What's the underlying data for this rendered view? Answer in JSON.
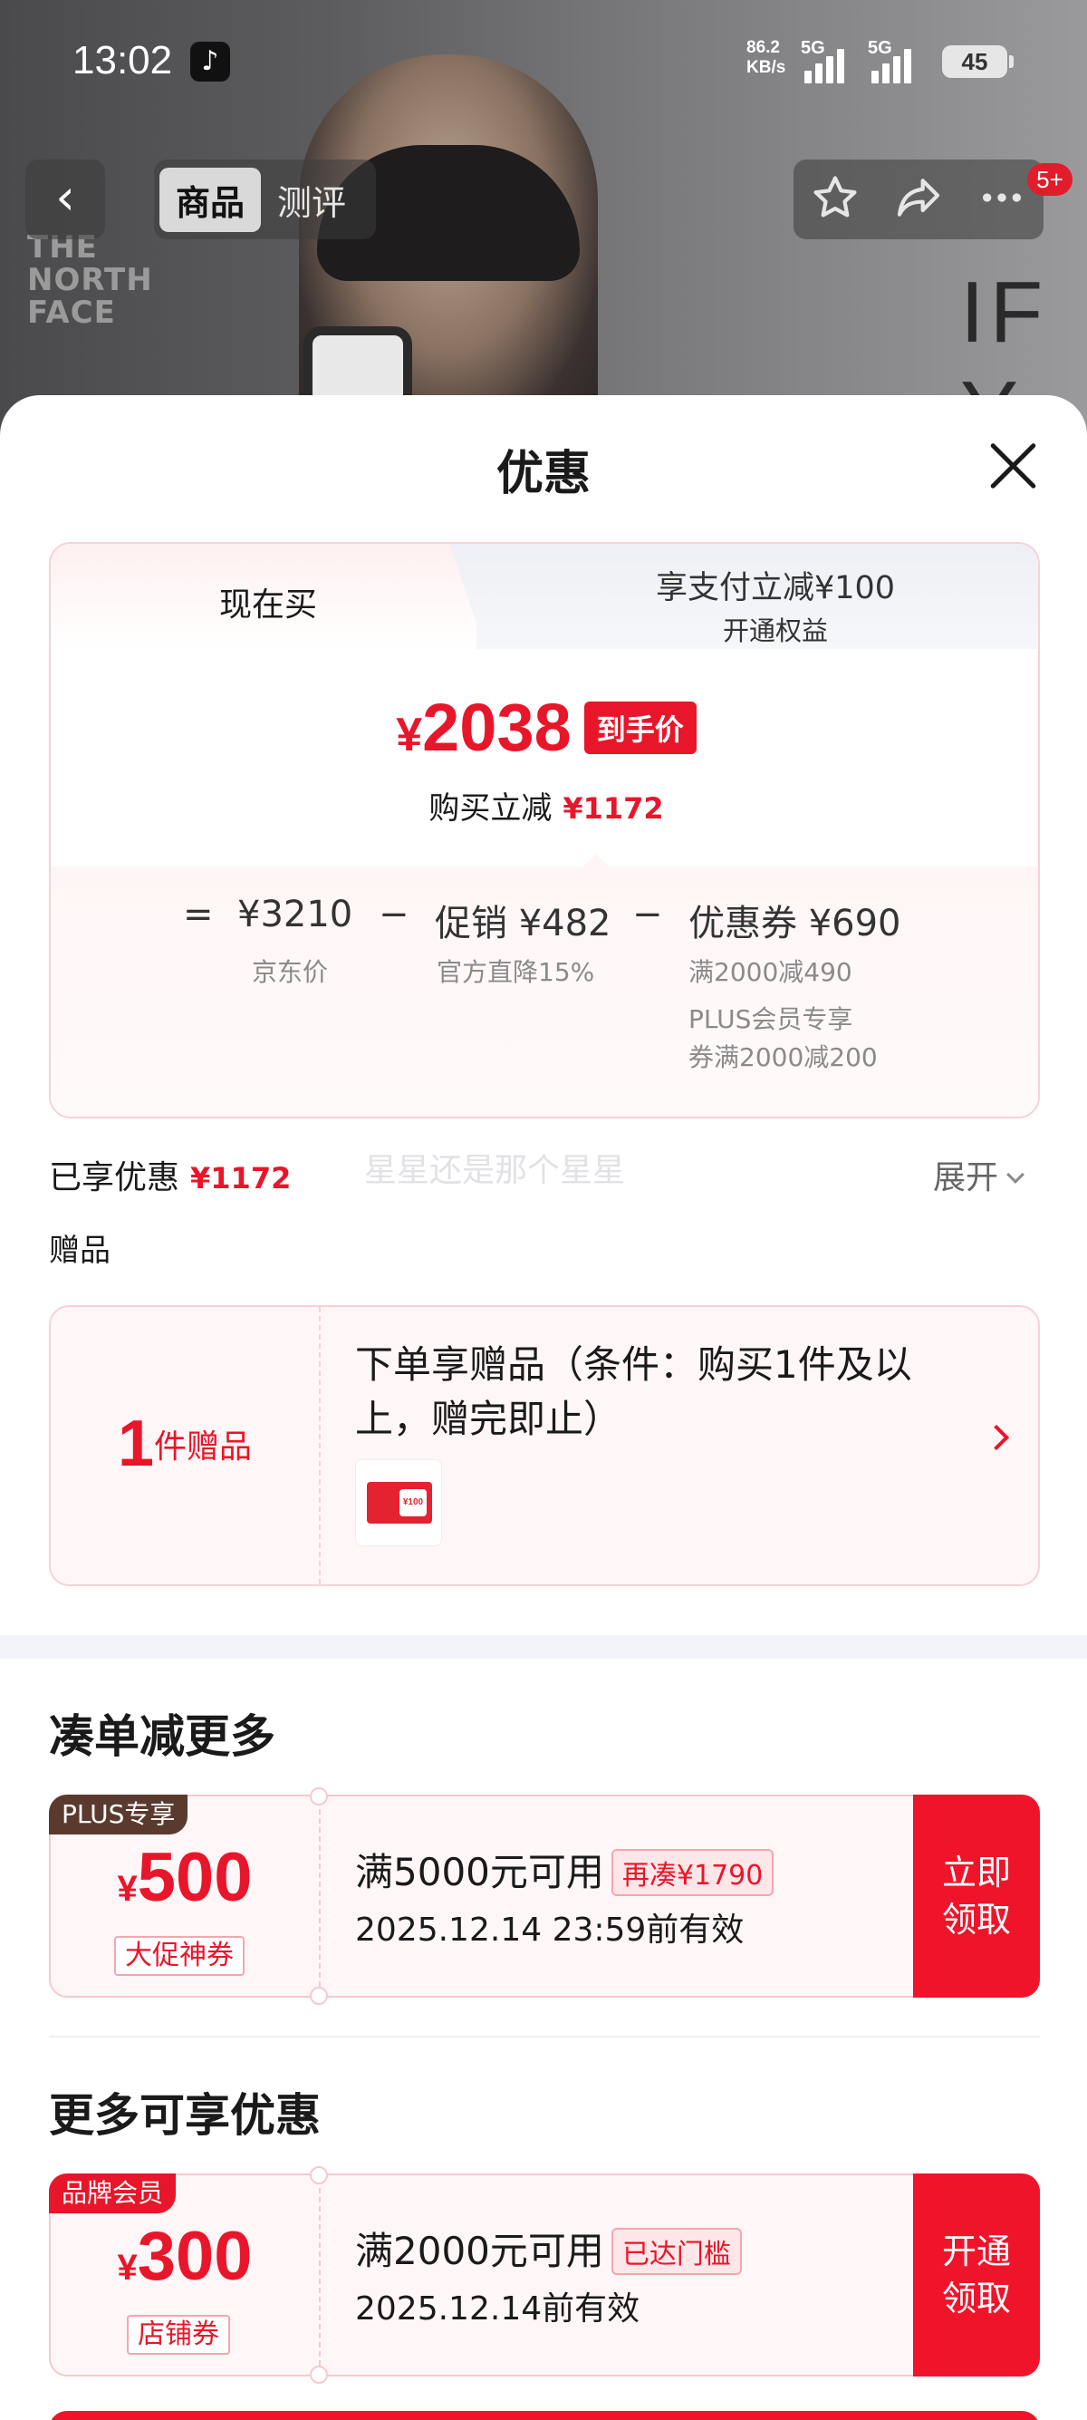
{
  "status_bar": {
    "time": "13:02",
    "speed_value": "86.2",
    "speed_unit": "KB/s",
    "sim1": "5G",
    "sim2": "5G",
    "battery": "45"
  },
  "nav": {
    "tabs": [
      {
        "label": "商品",
        "active": true
      },
      {
        "label": "测评",
        "active": false
      }
    ],
    "cart_badge": "5+",
    "icons": [
      "back-icon",
      "star-icon",
      "share-icon",
      "more-icon"
    ]
  },
  "hero": {
    "brand_logo_lines": [
      "THE",
      "NORTH",
      "FACE"
    ],
    "slogan": "IF Y"
  },
  "sheet": {
    "title": "优惠",
    "price_tabs": {
      "left_label": "现在买",
      "right_line1": "享支付立减¥100",
      "right_line2": "开通权益"
    },
    "final_price_symbol": "¥",
    "final_price": "2038",
    "final_price_tag": "到手价",
    "instant_cut_label": "购买立减",
    "instant_cut_value": "¥1172",
    "breakdown": {
      "equals": "=",
      "jd_price": "¥3210",
      "jd_price_label": "京东价",
      "minus": "−",
      "promo": "促销 ¥482",
      "promo_note": "官方直降15%",
      "coupon": "优惠券 ¥690",
      "coupon_note1": "满2000减490",
      "coupon_note2": "PLUS会员专享",
      "coupon_note3": "券满2000减200"
    },
    "enjoyed_label": "已享优惠",
    "enjoyed_value": "¥1172",
    "watermark": "星星还是那个星星",
    "expand_label": "展开",
    "gift_section": "赠品",
    "gift": {
      "count": "1",
      "count_unit": "件赠品",
      "desc": "下单享赠品（条件：购买1件及以上，赠完即止）",
      "thumb_text": "¥100"
    },
    "bundle_section": "凑单减更多",
    "more_section": "更多可享优惠",
    "coupons": [
      {
        "tag": "PLUS专享",
        "tag_color": "#5a3a2e",
        "symbol": "¥",
        "amount": "500",
        "kind": "大促神券",
        "condition": "满5000元可用",
        "pill": "再凑¥1790",
        "validity": "2025.12.14 23:59前有效",
        "button": "立即领取"
      },
      {
        "tag": "品牌会员",
        "tag_color": "#e8162a",
        "symbol": "¥",
        "amount": "300",
        "kind": "店铺券",
        "condition": "满2000元可用",
        "pill": "已达门槛",
        "validity": "2025.12.14前有效",
        "button": "开通领取"
      }
    ]
  },
  "colors": {
    "accent_red": "#e8162a",
    "card_border": "#f6d2d6"
  }
}
